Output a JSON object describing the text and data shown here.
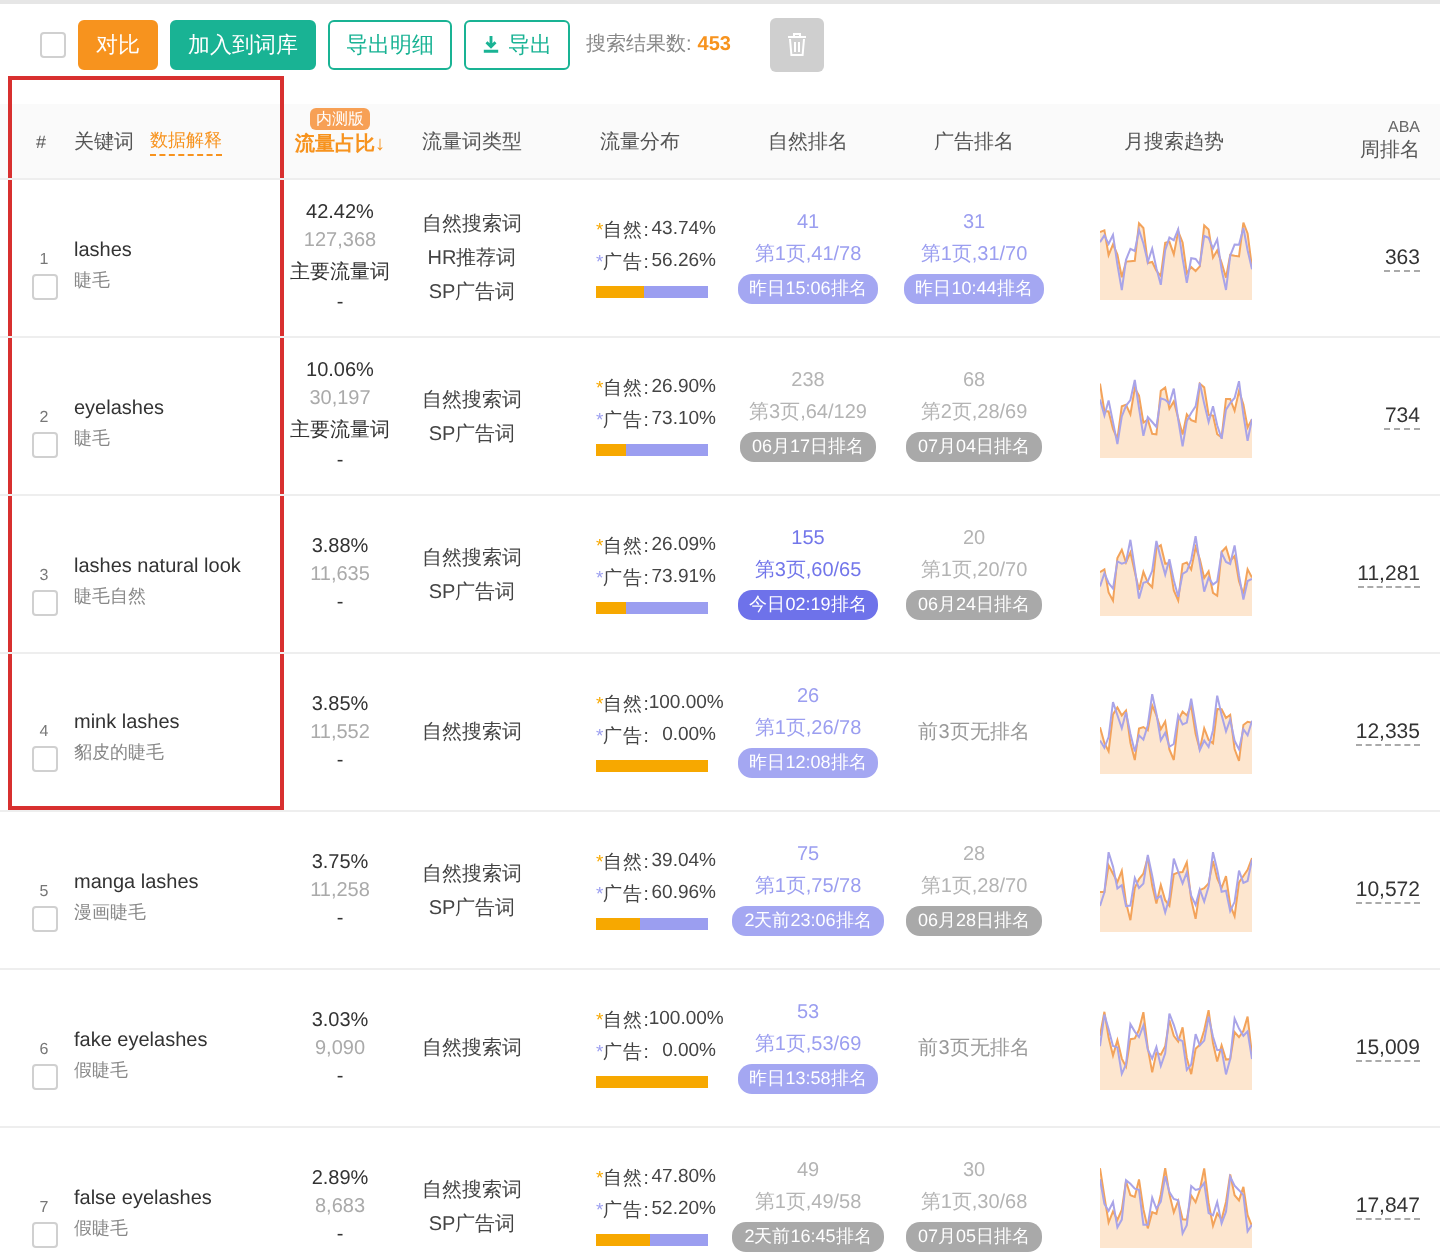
{
  "toolbar": {
    "select_all": {
      "checked": false
    },
    "buttons": [
      {
        "label": "对比",
        "kind": "orange"
      },
      {
        "label": "加入到词库",
        "kind": "green"
      },
      {
        "label": "导出明细",
        "kind": "outline"
      },
      {
        "label": "导出",
        "kind": "download"
      }
    ],
    "result_label": "搜索结果数:",
    "result_count": "453",
    "delete_disabled": true
  },
  "table": {
    "columns": [
      {
        "label": "#",
        "kind": "index"
      },
      {
        "label": "关键词",
        "kind": "keyword",
        "link": "数据解释"
      },
      {
        "label": "流量占比↓",
        "kind": "share",
        "badge": "内测版"
      },
      {
        "label": "流量词类型",
        "kind": "plain"
      },
      {
        "label": "流量分布",
        "kind": "plain"
      },
      {
        "label": "自然排名",
        "kind": "plain"
      },
      {
        "label": "广告排名",
        "kind": "plain"
      },
      {
        "label": "月搜索趋势",
        "kind": "plain"
      },
      {
        "label": "ABA",
        "sub": "周排名",
        "kind": "aba"
      }
    ],
    "rows": [
      {
        "index": "1",
        "keyword": "lashes",
        "translation": "睫毛",
        "checked": false,
        "highlighted": true,
        "share": "42.42%",
        "volume": "127,368",
        "tag": "主要流量词",
        "extra": "-",
        "types": [
          "自然搜索词",
          "HR推荐词",
          "SP广告词"
        ],
        "distribution": [
          {
            "marker": "*",
            "label": "自然:",
            "value": "43.74%",
            "kind": "natural"
          },
          {
            "marker": "*",
            "label": "广告:",
            "value": "56.26%",
            "kind": "ad"
          }
        ],
        "level": 0.4374,
        "natural_rank": {
          "kind": "ranked",
          "stale": false,
          "today": false,
          "rank": "41",
          "page": "第1页,41/78",
          "badge": "昨日15:06排名"
        },
        "ad_rank": {
          "kind": "ranked",
          "stale": false,
          "today": false,
          "rank": "31",
          "page": "第1页,31/70",
          "badge": "昨日10:44排名"
        },
        "aba": "363"
      },
      {
        "index": "2",
        "keyword": "eyelashes",
        "translation": "睫毛",
        "checked": false,
        "highlighted": true,
        "share": "10.06%",
        "volume": "30,197",
        "tag": "主要流量词",
        "extra": "-",
        "types": [
          "自然搜索词",
          "SP广告词"
        ],
        "distribution": [
          {
            "marker": "*",
            "label": "自然:",
            "value": "26.90%",
            "kind": "natural"
          },
          {
            "marker": "*",
            "label": "广告:",
            "value": "73.10%",
            "kind": "ad"
          }
        ],
        "level": 0.269,
        "natural_rank": {
          "kind": "ranked",
          "stale": true,
          "today": false,
          "rank": "238",
          "page": "第3页,64/129",
          "badge": "06月17日排名"
        },
        "ad_rank": {
          "kind": "ranked",
          "stale": true,
          "today": false,
          "rank": "68",
          "page": "第2页,28/69",
          "badge": "07月04日排名"
        },
        "aba": "734"
      },
      {
        "index": "3",
        "keyword": "lashes natural look",
        "translation": "睫毛自然",
        "checked": false,
        "highlighted": true,
        "share": "3.88%",
        "volume": "11,635",
        "extra": "-",
        "types": [
          "自然搜索词",
          "SP广告词"
        ],
        "distribution": [
          {
            "marker": "*",
            "label": "自然:",
            "value": "26.09%",
            "kind": "natural"
          },
          {
            "marker": "*",
            "label": "广告:",
            "value": "73.91%",
            "kind": "ad"
          }
        ],
        "level": 0.2609,
        "natural_rank": {
          "kind": "ranked",
          "stale": false,
          "today": true,
          "rank": "155",
          "page": "第3页,60/65",
          "badge": "今日02:19排名"
        },
        "ad_rank": {
          "kind": "ranked",
          "stale": true,
          "today": false,
          "rank": "20",
          "page": "第1页,20/70",
          "badge": "06月24日排名"
        },
        "aba": "11,281"
      },
      {
        "index": "4",
        "keyword": "mink lashes",
        "translation": "貂皮的睫毛",
        "checked": false,
        "highlighted": true,
        "share": "3.85%",
        "volume": "11,552",
        "extra": "-",
        "types": [
          "自然搜索词"
        ],
        "distribution": [
          {
            "marker": "*",
            "label": "自然:",
            "value": "100.00%",
            "kind": "natural"
          },
          {
            "marker": "*",
            "label": "广告:",
            "value": "0.00%",
            "kind": "ad"
          }
        ],
        "level": 1,
        "natural_rank": {
          "kind": "ranked",
          "stale": false,
          "today": false,
          "rank": "26",
          "page": "第1页,26/78",
          "badge": "昨日12:08排名"
        },
        "ad_rank": {
          "kind": "unranked",
          "text": "前3页无排名"
        },
        "aba": "12,335"
      },
      {
        "index": "5",
        "keyword": "manga lashes",
        "translation": "漫画睫毛",
        "checked": false,
        "highlighted": false,
        "share": "3.75%",
        "volume": "11,258",
        "extra": "-",
        "types": [
          "自然搜索词",
          "SP广告词"
        ],
        "distribution": [
          {
            "marker": "*",
            "label": "自然:",
            "value": "39.04%",
            "kind": "natural"
          },
          {
            "marker": "*",
            "label": "广告:",
            "value": "60.96%",
            "kind": "ad"
          }
        ],
        "level": 0.3904,
        "natural_rank": {
          "kind": "ranked",
          "stale": false,
          "today": false,
          "rank": "75",
          "page": "第1页,75/78",
          "badge": "2天前23:06排名"
        },
        "ad_rank": {
          "kind": "ranked",
          "stale": true,
          "today": false,
          "rank": "28",
          "page": "第1页,28/70",
          "badge": "06月28日排名"
        },
        "aba": "10,572"
      },
      {
        "index": "6",
        "keyword": "fake eyelashes",
        "translation": "假睫毛",
        "checked": false,
        "highlighted": false,
        "share": "3.03%",
        "volume": "9,090",
        "extra": "-",
        "types": [
          "自然搜索词"
        ],
        "distribution": [
          {
            "marker": "*",
            "label": "自然:",
            "value": "100.00%",
            "kind": "natural"
          },
          {
            "marker": "*",
            "label": "广告:",
            "value": "0.00%",
            "kind": "ad"
          }
        ],
        "level": 1,
        "natural_rank": {
          "kind": "ranked",
          "stale": false,
          "today": false,
          "rank": "53",
          "page": "第1页,53/69",
          "badge": "昨日13:58排名"
        },
        "ad_rank": {
          "kind": "unranked",
          "text": "前3页无排名"
        },
        "aba": "15,009"
      },
      {
        "index": "7",
        "keyword": "false eyelashes",
        "translation": "假睫毛",
        "checked": false,
        "highlighted": false,
        "share": "2.89%",
        "volume": "8,683",
        "extra": "-",
        "types": [
          "自然搜索词",
          "SP广告词"
        ],
        "distribution": [
          {
            "marker": "*",
            "label": "自然:",
            "value": "47.80%",
            "kind": "natural"
          },
          {
            "marker": "*",
            "label": "广告:",
            "value": "52.20%",
            "kind": "ad"
          }
        ],
        "level": 0.478,
        "natural_rank": {
          "kind": "ranked",
          "stale": true,
          "today": false,
          "rank": "49",
          "page": "第1页,49/58",
          "badge": "2天前16:45排名"
        },
        "ad_rank": {
          "kind": "ranked",
          "stale": true,
          "today": false,
          "rank": "30",
          "page": "第1页,30/68",
          "badge": "07月05日排名"
        },
        "aba": "17,847"
      }
    ]
  }
}
